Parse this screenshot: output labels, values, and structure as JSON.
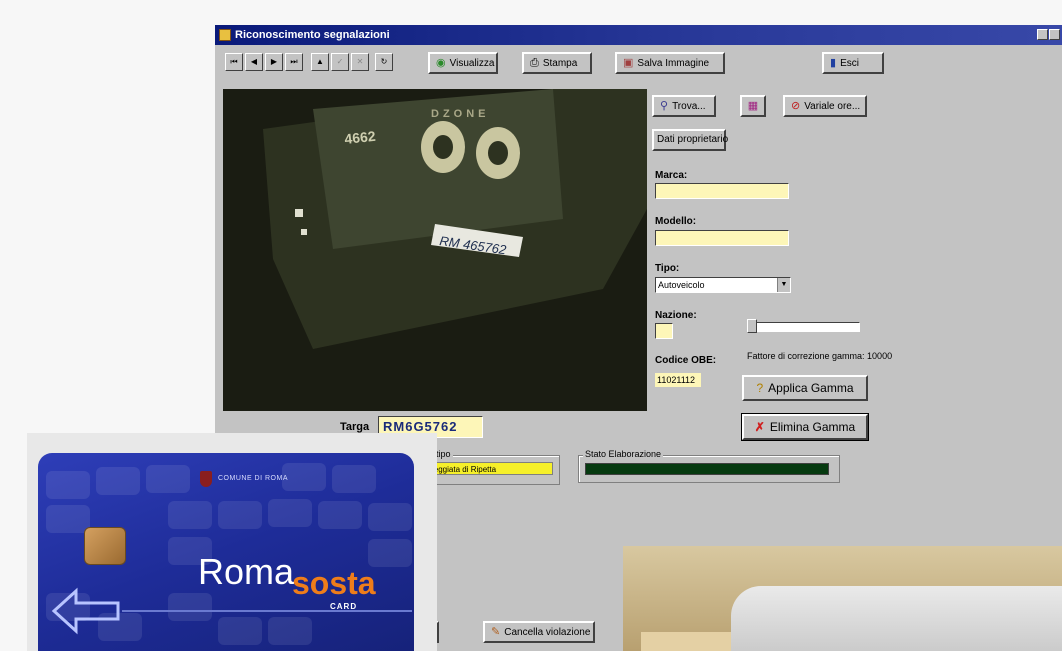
{
  "window": {
    "title": "Riconoscimento segnalazioni"
  },
  "toolbar": {
    "nav_first": "⏮",
    "nav_prev": "◀",
    "nav_next": "▶",
    "nav_last": "⏭",
    "nav_up": "▲",
    "nav_check": "✓",
    "nav_cancel": "✕",
    "nav_refresh": "↻",
    "visualizza_label": "Visualizza",
    "stampa_label": "Stampa",
    "salva_label": "Salva Immagine",
    "esci_label": "Esci"
  },
  "image": {
    "plate_text": "RM 465762",
    "meter_number": "4662",
    "meter_label": "DZONE"
  },
  "side": {
    "trova_label": "Trova...",
    "variale_label": "Variale ore...",
    "dati_label": "Dati proprietario",
    "marca_label": "Marca:",
    "modello_label": "Modello:",
    "tipo_label": "Tipo:",
    "tipo_value": "Autoveicolo",
    "nazione_label": "Nazione:",
    "codice_label": "Codice OBE:",
    "codice_value": "11021112",
    "gamma_text": "Fattore di correzione gamma: 10000",
    "applica_label": "Applica Gamma",
    "elimina_label": "Elimina Gamma"
  },
  "bottom": {
    "targa_label": "Targa",
    "targa_value": "RM6G5762",
    "tipo_group_label": "Doc. tipo",
    "tipo_group_value": "Passeggiata di Ripetta",
    "stato_label": "Stato Elaborazione",
    "cancella_label": "Cancella violazione"
  },
  "card": {
    "issuer": "COMUNE DI ROMA",
    "brand_roma": "Roma",
    "brand_sosta": "sosta",
    "brand_card": "CARD"
  },
  "colors": {
    "title_bar": "#0a1a7a",
    "window_bg": "#c3c3c3",
    "field_yellow": "#fdf6b8",
    "card_blue": "#2e3eb8",
    "sosta_orange": "#ef7d1a"
  }
}
